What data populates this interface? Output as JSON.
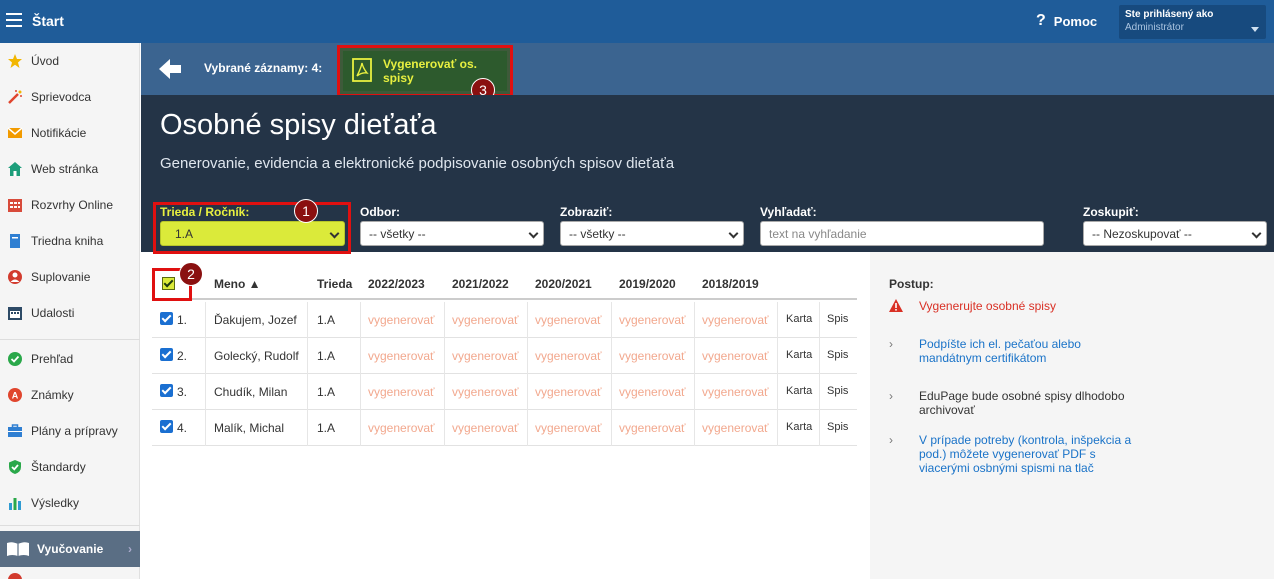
{
  "topbar": {
    "start_label": "Štart",
    "help_label": "Pomoc",
    "user_title": "Ste prihlásený ako",
    "user_name": "Administrátor"
  },
  "sidebar": {
    "items": [
      {
        "label": "Úvod",
        "icon": "star-icon",
        "color": "#f2b600"
      },
      {
        "label": "Sprievodca",
        "icon": "magic-wand-icon",
        "color": "#e0452d"
      },
      {
        "label": "Notifikácie",
        "icon": "envelope-icon",
        "color": "#f29b00"
      },
      {
        "label": "Web stránka",
        "icon": "house-icon",
        "color": "#1d9e7b"
      },
      {
        "label": "Rozvrhy Online",
        "icon": "calendar-icon",
        "color": "#d84b3b"
      },
      {
        "label": "Triedna kniha",
        "icon": "book-icon",
        "color": "#2f7fd2"
      },
      {
        "label": "Suplovanie",
        "icon": "user-icon",
        "color": "#d23b2e"
      },
      {
        "label": "Udalosti",
        "icon": "event-calendar-icon",
        "color": "#2d4a66"
      },
      {
        "label": "Prehľad",
        "icon": "check-circle-icon",
        "color": "#2aa84a"
      },
      {
        "label": "Známky",
        "icon": "grade-icon",
        "color": "#e0452d"
      },
      {
        "label": "Plány a prípravy",
        "icon": "briefcase-icon",
        "color": "#2f7fd2"
      },
      {
        "label": "Štandardy",
        "icon": "shield-check-icon",
        "color": "#2aa84a"
      },
      {
        "label": "Výsledky",
        "icon": "bar-chart-icon",
        "color": "#2f9bd2"
      }
    ],
    "active_label": "Vyučovanie"
  },
  "actionbar": {
    "selected_text": "Vybrané záznamy: 4:",
    "generate_label": "Vygenerovať os. spisy"
  },
  "hero": {
    "title": "Osobné spisy dieťaťa",
    "subtitle": "Generovanie, evidencia a elektronické podpisovanie osobných spisov dieťaťa"
  },
  "filters": {
    "trieda_label": "Trieda / Ročník:",
    "trieda_value": "1.A",
    "odbor_label": "Odbor:",
    "odbor_value": "-- všetky --",
    "zobrazit_label": "Zobraziť:",
    "zobrazit_value": "-- všetky --",
    "vyhladat_label": "Vyhľadať:",
    "vyhladat_placeholder": "text na vyhľadanie",
    "zoskupit_label": "Zoskupiť:",
    "zoskupit_value": "-- Nezoskupovať --"
  },
  "markers": {
    "m1": "1",
    "m2": "2",
    "m3": "3"
  },
  "table": {
    "headers": {
      "meno": "Meno ▲",
      "trieda": "Trieda",
      "y1": "2022/2023",
      "y2": "2021/2022",
      "y3": "2020/2021",
      "y4": "2019/2020",
      "y5": "2018/2019"
    },
    "rows": [
      {
        "num": "1.",
        "name": "Ďakujem, Jozef",
        "class": "1.A",
        "gen": "vygenerovať",
        "karta": "Karta",
        "spis": "Spis"
      },
      {
        "num": "2.",
        "name": "Golecký, Rudolf",
        "class": "1.A",
        "gen": "vygenerovať",
        "karta": "Karta",
        "spis": "Spis"
      },
      {
        "num": "3.",
        "name": "Chudík, Milan",
        "class": "1.A",
        "gen": "vygenerovať",
        "karta": "Karta",
        "spis": "Spis"
      },
      {
        "num": "4.",
        "name": "Malík, Michal",
        "class": "1.A",
        "gen": "vygenerovať",
        "karta": "Karta",
        "spis": "Spis"
      }
    ]
  },
  "right_panel": {
    "title": "Postup:",
    "steps": [
      {
        "text": "Vygenerujte osobné spisy",
        "style": "red"
      },
      {
        "text": "Podpíšte ich el. pečaťou alebo mandátnym certifikátom",
        "style": "blue"
      },
      {
        "text": "EduPage bude osobné spisy dlhodobo archivovať",
        "style": "dark"
      },
      {
        "text": "V prípade potreby (kontrola, inšpekcia a pod.) môžete vygenerovať PDF s viacerými osbnými spismi na tlač",
        "style": "blue"
      }
    ]
  }
}
